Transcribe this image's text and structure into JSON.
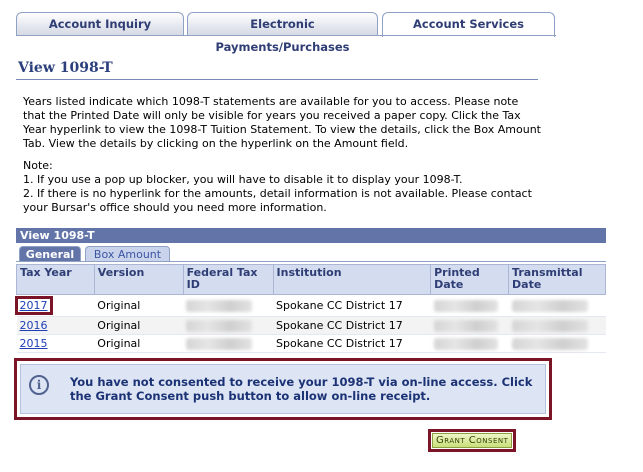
{
  "tabs": [
    {
      "label": "Account Inquiry"
    },
    {
      "label": "Electronic Payments/Purchases"
    },
    {
      "label": "Account Services"
    }
  ],
  "page_title": "View 1098-T",
  "intro": "Years listed indicate which 1098-T statements are available for you to access.  Please note that the Printed Date will only be visible for years you received a paper copy.  Click the Tax Year hyperlink to view the 1098-T Tuition Statement.  To view the details, click the Box Amount Tab.  View the details by clicking on the hyperlink on the Amount field.",
  "notes": {
    "heading": "Note:",
    "item1": "1.  If you use a pop up blocker, you will have to disable it to display your 1098-T.",
    "item2": "2.  If there is no hyperlink for the amounts, detail information is not available.  Please contact your Bursar's office should you need more information."
  },
  "grid": {
    "title": "View 1098-T",
    "tabs": {
      "general": "General",
      "box_amount": "Box Amount"
    },
    "columns": [
      "Tax Year",
      "Version",
      "Federal Tax ID",
      "Institution",
      "Printed Date",
      "Transmittal Date"
    ],
    "rows": [
      {
        "tax_year": "2017",
        "version": "Original",
        "institution": "Spokane CC District 17"
      },
      {
        "tax_year": "2016",
        "version": "Original",
        "institution": "Spokane CC District 17"
      },
      {
        "tax_year": "2015",
        "version": "Original",
        "institution": "Spokane CC District 17"
      }
    ]
  },
  "message": {
    "icon": "info-icon",
    "glyph": "i",
    "text": "You have not consented to receive your 1098-T via on-line access.  Click the Grant Consent push button to allow on-line receipt."
  },
  "consent_button": "Grant Consent",
  "colors": {
    "highlight": "#7a1426",
    "header": "#6374a8",
    "link": "#1f40b5"
  }
}
